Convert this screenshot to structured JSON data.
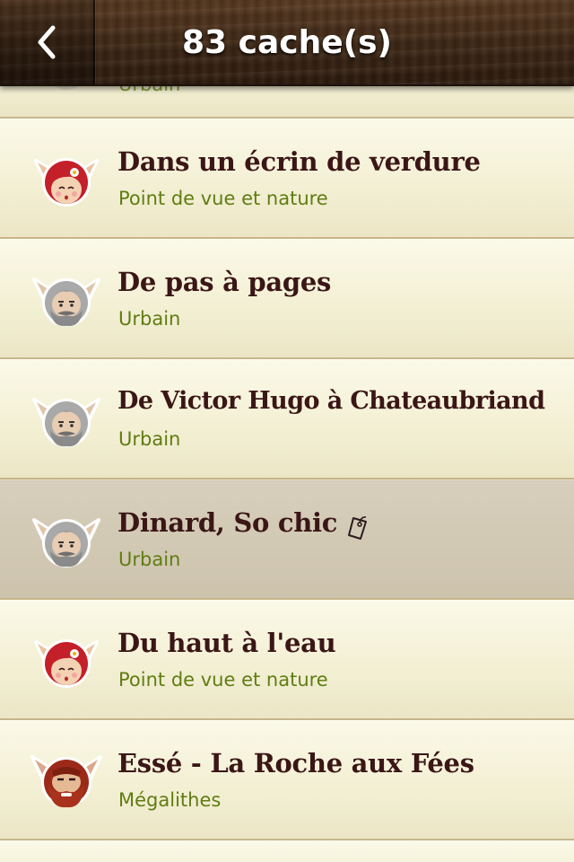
{
  "header": {
    "title": "83 cache(s)",
    "back_icon": "chevron-left-icon"
  },
  "partial_row": {
    "subtitle": "Urbain"
  },
  "rows": [
    {
      "title": "Dans un écrin de verdure",
      "subtitle": "Point de vue et nature",
      "avatar": "fairy-avatar-icon",
      "selected": false
    },
    {
      "title": "De pas à pages",
      "subtitle": "Urbain",
      "avatar": "old-man-avatar-icon",
      "selected": false
    },
    {
      "title": "De Victor Hugo à Chateaubriand",
      "subtitle": "Urbain",
      "avatar": "old-man-avatar-icon",
      "selected": false
    },
    {
      "title": "Dinard, So chic",
      "subtitle": "Urbain",
      "avatar": "old-man-avatar-icon",
      "selected": true,
      "badge_icon": "tag-icon"
    },
    {
      "title": "Du haut à l'eau",
      "subtitle": "Point de vue et nature",
      "avatar": "fairy-avatar-icon",
      "selected": false
    },
    {
      "title": "Essé - La Roche aux Fées",
      "subtitle": "Mégalithes",
      "avatar": "korrigan-avatar-icon",
      "selected": false
    }
  ],
  "colors": {
    "title_text": "#3b1616",
    "subtitle_text": "#5f7d12",
    "row_background": "#f3efd3",
    "selected_row_background": "#d0c7b1",
    "header_wood": "#3e2715"
  }
}
